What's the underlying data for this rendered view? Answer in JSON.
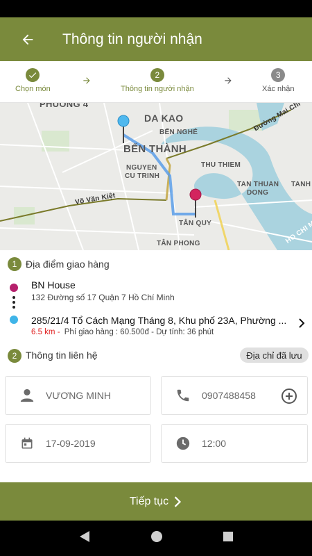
{
  "header": {
    "title": "Thông tin người nhận"
  },
  "steps": [
    {
      "label": "Chọn món",
      "number": "",
      "state": "done"
    },
    {
      "label": "Thông tin người nhận",
      "number": "2",
      "state": "active"
    },
    {
      "label": "Xác nhận",
      "number": "3",
      "state": "pending"
    }
  ],
  "map": {
    "labels": [
      "PHUONG 4",
      "DA KAO",
      "BẾN NGHÉ",
      "BẾN THÀNH",
      "NGUYEN",
      "CU TRINH",
      "Võ Văn Kiệt",
      "Đường Mai Chí",
      "THU THIEM",
      "TAN THUAN",
      "DONG",
      "TANH",
      "TÂN QUY",
      "TÂN PHONG",
      "HO CHI MIN"
    ]
  },
  "delivery": {
    "section_number": "1",
    "section_title": "Địa điểm giao hàng",
    "origin": {
      "name": "BN House",
      "address": "132 Đường số 17 Quận 7 Hồ Chí Minh"
    },
    "destination": {
      "address": "285/21/4 Tổ Cách Mạng Tháng 8, Khu phố 23A, Phường ..."
    },
    "distance": "6.5 km -",
    "fee_info": "Phí giao hàng : 60.500đ - Dự tính: 36 phút"
  },
  "contact": {
    "section_number": "2",
    "section_title": "Thông tin liên hệ",
    "saved_address_label": "Địa chỉ đã lưu",
    "name": "VƯƠNG MINH",
    "phone": "0907488458",
    "date": "17-09-2019",
    "time": "12:00"
  },
  "footer": {
    "continue_label": "Tiếp tục"
  },
  "colors": {
    "primary": "#7a8a3c",
    "origin_dot": "#b5206c",
    "dest_dot": "#3fb4e8",
    "distance": "#e02020"
  }
}
